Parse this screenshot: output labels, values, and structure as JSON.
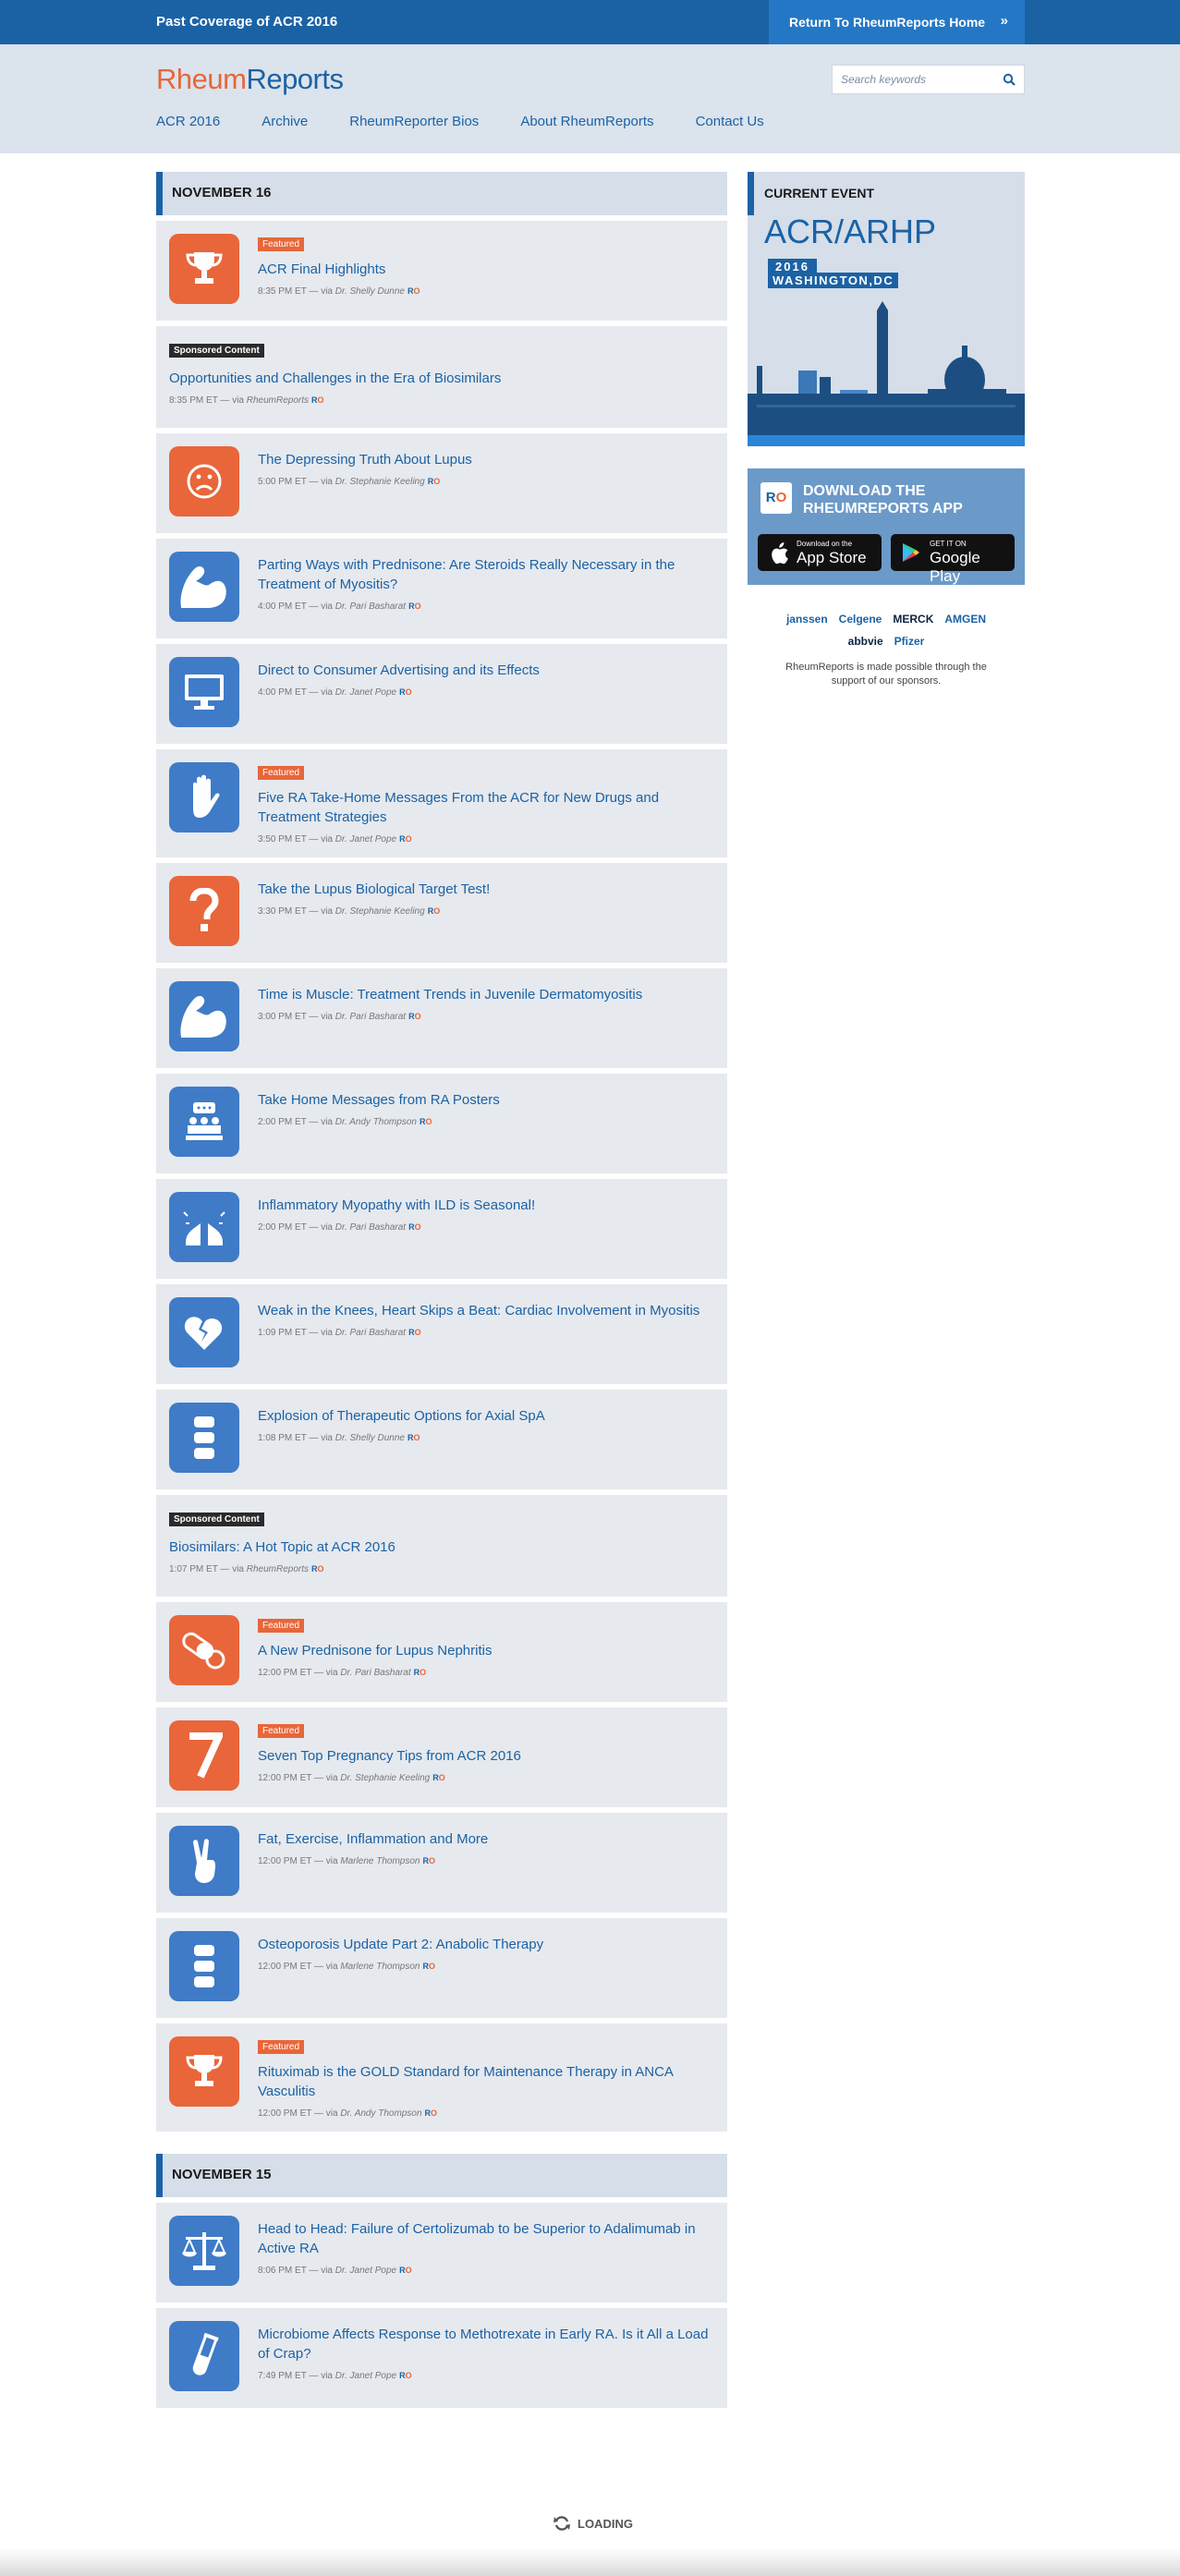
{
  "topbar": {
    "past_coverage": "Past Coverage of ACR 2016",
    "return_home": "Return To RheumReports Home"
  },
  "brand": {
    "part1": "Rheum",
    "part2": "Reports"
  },
  "search": {
    "placeholder": "Search keywords"
  },
  "nav": [
    "ACR 2016",
    "Archive",
    "RheumReporter Bios",
    "About RheumReports",
    "Contact Us"
  ],
  "days": [
    {
      "label": "NOVEMBER 16",
      "posts": [
        {
          "icon": "trophy-icon",
          "color": "or",
          "featured": true,
          "title": "ACR Final Highlights",
          "time": "8:35 PM ET",
          "via": "Dr. Shelly Dunne"
        },
        {
          "sponsored": true,
          "title": "Opportunities and Challenges in the Era of Biosimilars",
          "time": "8:35 PM ET",
          "via": "RheumReports"
        },
        {
          "icon": "sad-face-icon",
          "color": "or",
          "title": "The Depressing Truth About Lupus",
          "time": "5:00 PM ET",
          "via": "Dr. Stephanie Keeling"
        },
        {
          "icon": "muscle-arm-icon",
          "color": "bl",
          "title": "Parting Ways with Prednisone: Are Steroids Really Necessary in the Treatment of Myositis?",
          "time": "4:00 PM ET",
          "via": "Dr. Pari Basharat"
        },
        {
          "icon": "monitor-icon",
          "color": "bl",
          "title": "Direct to Consumer Advertising and its Effects",
          "time": "4:00 PM ET",
          "via": "Dr. Janet Pope"
        },
        {
          "icon": "hand-icon",
          "color": "bl",
          "featured": true,
          "title": "Five RA Take-Home Messages From the ACR for New Drugs and Treatment Strategies",
          "time": "3:50 PM ET",
          "via": "Dr. Janet Pope"
        },
        {
          "icon": "question-mark-icon",
          "color": "or",
          "title": "Take the Lupus Biological Target Test!",
          "time": "3:30 PM ET",
          "via": "Dr. Stephanie Keeling"
        },
        {
          "icon": "muscle-arm-icon",
          "color": "bl",
          "title": "Time is Muscle: Treatment Trends in Juvenile Dermatomyositis",
          "time": "3:00 PM ET",
          "via": "Dr. Pari Basharat"
        },
        {
          "icon": "audience-icon",
          "color": "bl",
          "title": "Take Home Messages from RA Posters",
          "time": "2:00 PM ET",
          "via": "Dr. Andy Thompson"
        },
        {
          "icon": "lungs-icon",
          "color": "bl",
          "title": "Inflammatory Myopathy with ILD is Seasonal!",
          "time": "2:00 PM ET",
          "via": "Dr. Pari Basharat"
        },
        {
          "icon": "broken-heart-icon",
          "color": "bl",
          "title": "Weak in the Knees, Heart Skips a Beat: Cardiac Involvement in Myositis",
          "time": "1:09 PM ET",
          "via": "Dr. Pari Basharat"
        },
        {
          "icon": "spine-icon",
          "color": "bl",
          "title": "Explosion of Therapeutic Options for Axial SpA",
          "time": "1:08 PM ET",
          "via": "Dr. Shelly Dunne"
        },
        {
          "sponsored": true,
          "title": "Biosimilars: A Hot Topic at ACR 2016",
          "time": "1:07 PM ET",
          "via": "RheumReports"
        },
        {
          "icon": "pill-icon",
          "color": "or",
          "featured": true,
          "title": "A New Prednisone for Lupus Nephritis",
          "time": "12:00 PM ET",
          "via": "Dr. Pari Basharat"
        },
        {
          "icon": "number-seven-icon",
          "color": "or",
          "featured": true,
          "title": "Seven Top Pregnancy Tips from ACR 2016",
          "time": "12:00 PM ET",
          "via": "Dr. Stephanie Keeling"
        },
        {
          "icon": "peace-hand-icon",
          "color": "bl",
          "title": "Fat, Exercise, Inflammation and More",
          "time": "12:00 PM ET",
          "via": "Marlene Thompson"
        },
        {
          "icon": "spine-icon",
          "color": "bl",
          "title": "Osteoporosis Update Part 2: Anabolic Therapy",
          "time": "12:00 PM ET",
          "via": "Marlene Thompson"
        },
        {
          "icon": "trophy-icon",
          "color": "or",
          "featured": true,
          "title": "Rituximab is the GOLD Standard for Maintenance Therapy in ANCA Vasculitis",
          "time": "12:00 PM ET",
          "via": "Dr. Andy Thompson"
        }
      ]
    },
    {
      "label": "NOVEMBER 15",
      "posts": [
        {
          "icon": "scales-icon",
          "color": "bl",
          "title": "Head to Head: Failure of Certolizumab to be Superior to Adalimumab in Active RA",
          "time": "8:06 PM ET",
          "via": "Dr. Janet Pope"
        },
        {
          "icon": "test-tube-icon",
          "color": "bl",
          "title": "Microbiome Affects Response to Methotrexate in Early RA. Is it All a Load of Crap?",
          "time": "7:49 PM ET",
          "via": "Dr. Janet Pope"
        }
      ]
    }
  ],
  "labels": {
    "featured": "Featured",
    "sponsored": "Sponsored Content",
    "via": "via",
    "ro_r": "R",
    "ro_o": "O"
  },
  "event": {
    "heading": "CURRENT EVENT",
    "name": "ACR/ARHP",
    "year": "2016",
    "city": "WASHINGTON,DC"
  },
  "app": {
    "line1": "DOWNLOAD THE",
    "line2": "RHEUMREPORTS APP",
    "apple_small": "Download on the",
    "apple_big": "App Store",
    "google_small": "GET IT ON",
    "google_big": "Google Play"
  },
  "sponsors": {
    "names": [
      "janssen",
      "Celgene",
      "MERCK",
      "AMGEN",
      "abbvie",
      "Pfizer"
    ],
    "note": "RheumReports is made possible through the support of our sponsors."
  },
  "loading": "LOADING",
  "colors": {
    "brand_blue": "#1b62a5",
    "brand_orange": "#e8663a",
    "icon_blue": "#3f7bc7"
  }
}
